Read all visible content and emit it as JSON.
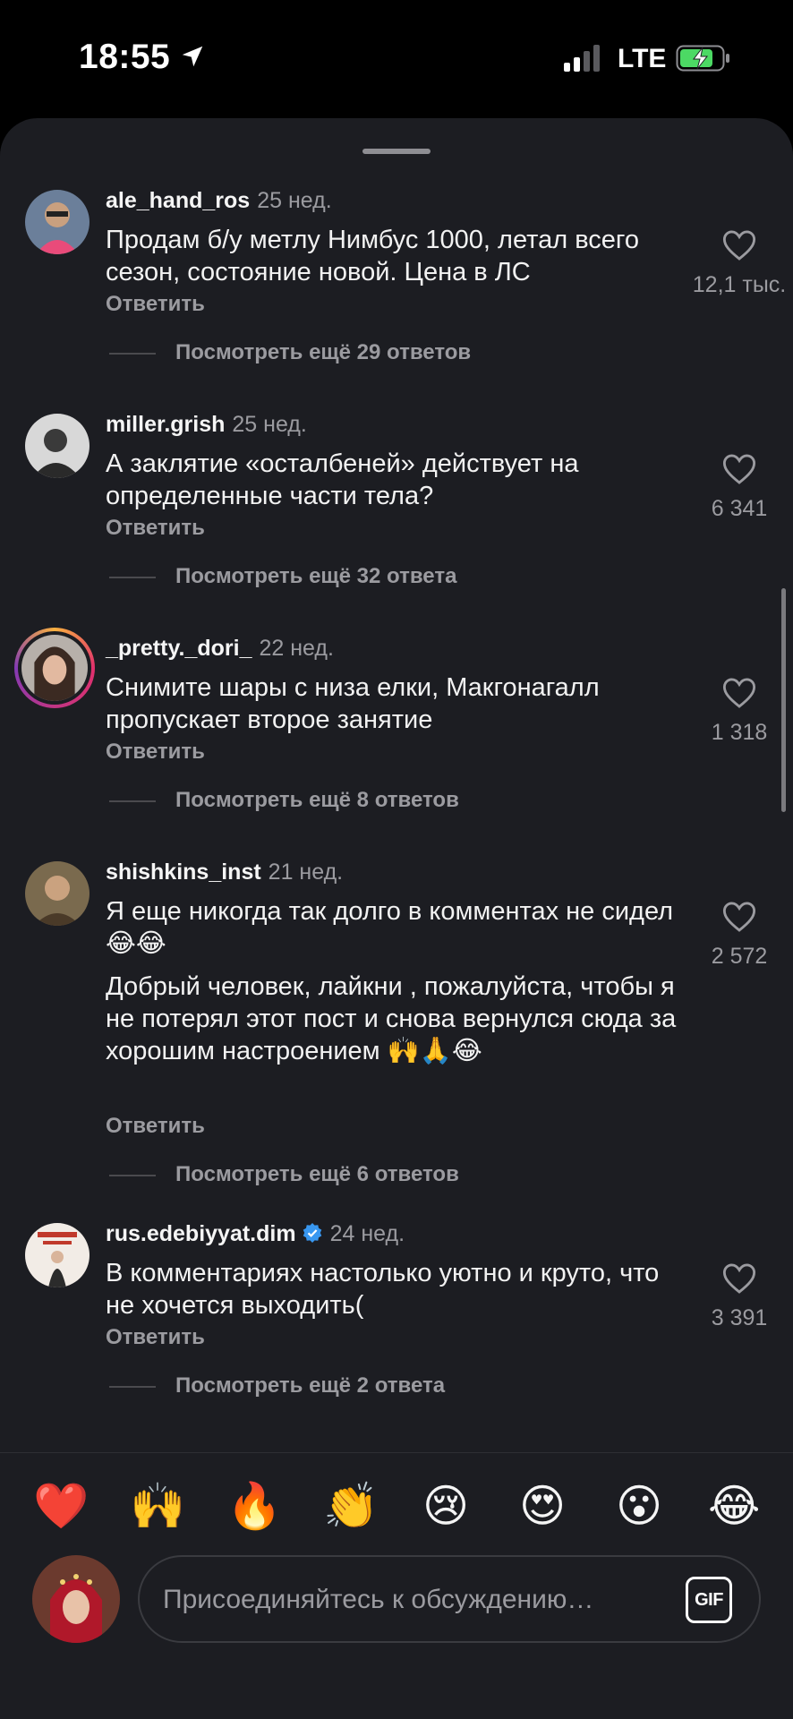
{
  "status_bar": {
    "time": "18:55",
    "network": "LTE"
  },
  "reply_label": "Ответить",
  "comments": [
    {
      "username": "ale_hand_ros",
      "age": "25 нед.",
      "text": "Продам б/у метлу Нимбус 1000, летал всего сезон, состояние новой. Цена в ЛС",
      "likes": "12,1 тыс.",
      "more_replies": "Посмотреть ещё 29 ответов"
    },
    {
      "username": "miller.grish",
      "age": "25 нед.",
      "text": "А заклятие «осталбеней» действует на определенные части тела?",
      "likes": "6 341",
      "more_replies": "Посмотреть ещё 32 ответа"
    },
    {
      "username": "_pretty._dori_",
      "age": "22 нед.",
      "text": "Снимите шары с низа елки, Макгонагалл пропускает второе занятие",
      "likes": "1 318",
      "more_replies": "Посмотреть ещё 8 ответов"
    },
    {
      "username": "shishkins_inst",
      "age": "21 нед.",
      "text": "Я еще никогда так долго в комментах не сидел 😂😂",
      "text2": "Добрый человек, лайкни , пожалуйста, чтобы я не потерял этот пост и снова вернулся сюда за хорошим настроением 🙌🙏😂",
      "likes": "2 572",
      "more_replies": "Посмотреть ещё 6 ответов"
    },
    {
      "username": "rus.edebiyyat.dim",
      "age": "24 нед.",
      "text": "В комментариях настолько уютно и круто, что не хочется выходить(",
      "likes": "3 391",
      "more_replies": "Посмотреть ещё 2 ответа"
    }
  ],
  "emoji_bar": [
    "❤️",
    "🙌",
    "🔥",
    "👏",
    "😢",
    "😍",
    "😮",
    "😂"
  ],
  "input": {
    "placeholder": "Присоединяйтесь к обсуждению…",
    "gif_label": "GIF"
  },
  "colors": {
    "background": "#000000",
    "sheet": "#1c1d22",
    "text": "#f5f5f5",
    "secondary": "#9b9ba0",
    "verified": "#3897f0"
  }
}
